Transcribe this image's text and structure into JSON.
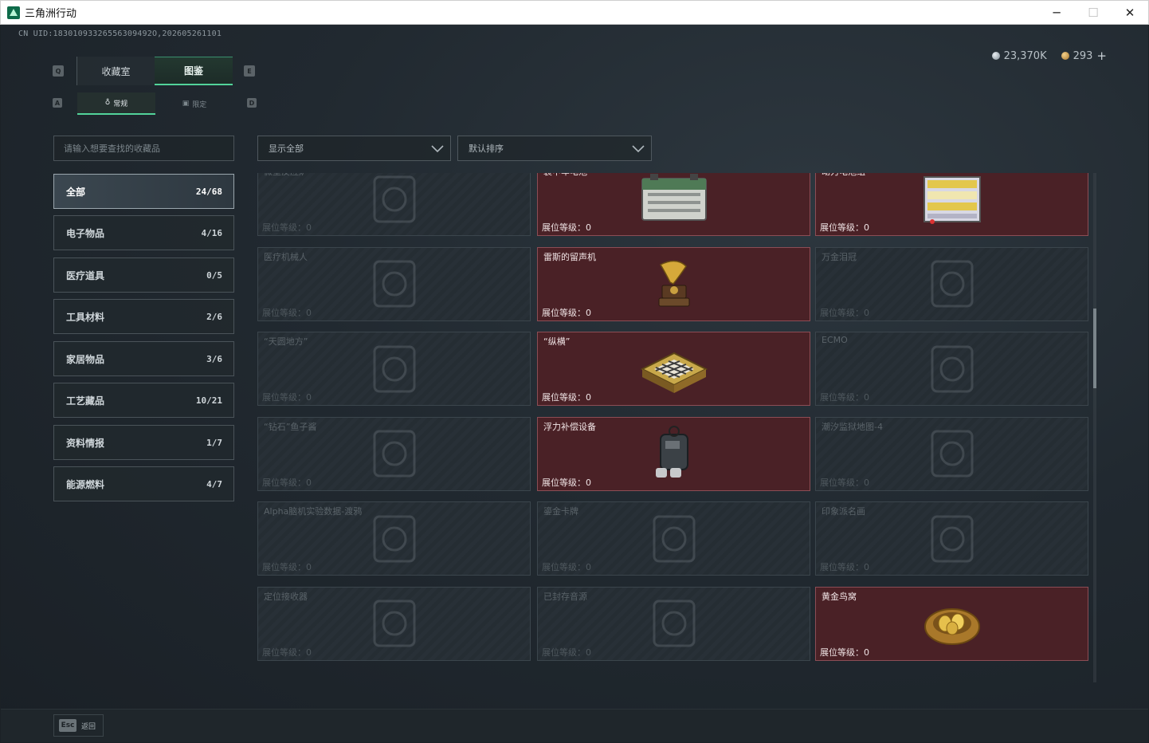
{
  "window": {
    "title": "三角洲行动",
    "minimize": "─",
    "maximize": "☐",
    "close": "✕"
  },
  "uid_text": "CN UID:18301093326556309492O,202605261101",
  "currency": {
    "silver": "23,370K",
    "gold": "293",
    "plus": "+"
  },
  "keys": {
    "q": "Q",
    "e": "E",
    "a": "A",
    "d": "D"
  },
  "tabs": {
    "collection": "收藏室",
    "catalog": "图鉴",
    "regular": "常规",
    "limited": "限定"
  },
  "search": {
    "placeholder": "请输入想要查找的收藏品"
  },
  "filters": {
    "show": "显示全部",
    "sort": "默认排序"
  },
  "categories": [
    {
      "label": "全部",
      "count": "24/68"
    },
    {
      "label": "电子物品",
      "count": "4/16"
    },
    {
      "label": "医疗道具",
      "count": "0/5"
    },
    {
      "label": "工具材料",
      "count": "2/6"
    },
    {
      "label": "家居物品",
      "count": "3/6"
    },
    {
      "label": "工艺藏品",
      "count": "10/21"
    },
    {
      "label": "资料情报",
      "count": "1/7"
    },
    {
      "label": "能源燃料",
      "count": "4/7"
    }
  ],
  "level_label": "展位等级：0",
  "items": [
    {
      "name": "微型反应炉",
      "owned": false,
      "icon": "reactor-icon"
    },
    {
      "name": "装甲车电池",
      "owned": true,
      "icon": "battery-icon"
    },
    {
      "name": "动力电池组",
      "owned": true,
      "icon": "battery-pack-icon"
    },
    {
      "name": "医疗机械人",
      "owned": false,
      "icon": "medical-robot-icon"
    },
    {
      "name": "雷斯的留声机",
      "owned": true,
      "icon": "gramophone-icon"
    },
    {
      "name": "万金泪冠",
      "owned": false,
      "icon": "crown-icon"
    },
    {
      "name": "“天圆地方”",
      "owned": false,
      "icon": "globe-icon"
    },
    {
      "name": "“纵横”",
      "owned": true,
      "icon": "chessboard-icon"
    },
    {
      "name": "ECMO",
      "owned": false,
      "icon": "ecmo-icon"
    },
    {
      "name": "“钻石”鱼子酱",
      "owned": false,
      "icon": "caviar-icon"
    },
    {
      "name": "浮力补偿设备",
      "owned": true,
      "icon": "diving-gear-icon"
    },
    {
      "name": "潮汐监狱地图-4",
      "owned": false,
      "icon": "map-icon"
    },
    {
      "name": "Alpha脑机实验数据-渡鸦",
      "owned": false,
      "icon": "data-drive-icon"
    },
    {
      "name": "鎏金卡牌",
      "owned": false,
      "icon": "card-icon"
    },
    {
      "name": "印象派名画",
      "owned": false,
      "icon": "painting-icon"
    },
    {
      "name": "定位接收器",
      "owned": false,
      "icon": "receiver-icon"
    },
    {
      "name": "已封存音源",
      "owned": false,
      "icon": "audio-icon"
    },
    {
      "name": "黄金鸟窝",
      "owned": true,
      "icon": "golden-nest-icon"
    }
  ],
  "footer": {
    "esc": "Esc",
    "back": "返回"
  }
}
